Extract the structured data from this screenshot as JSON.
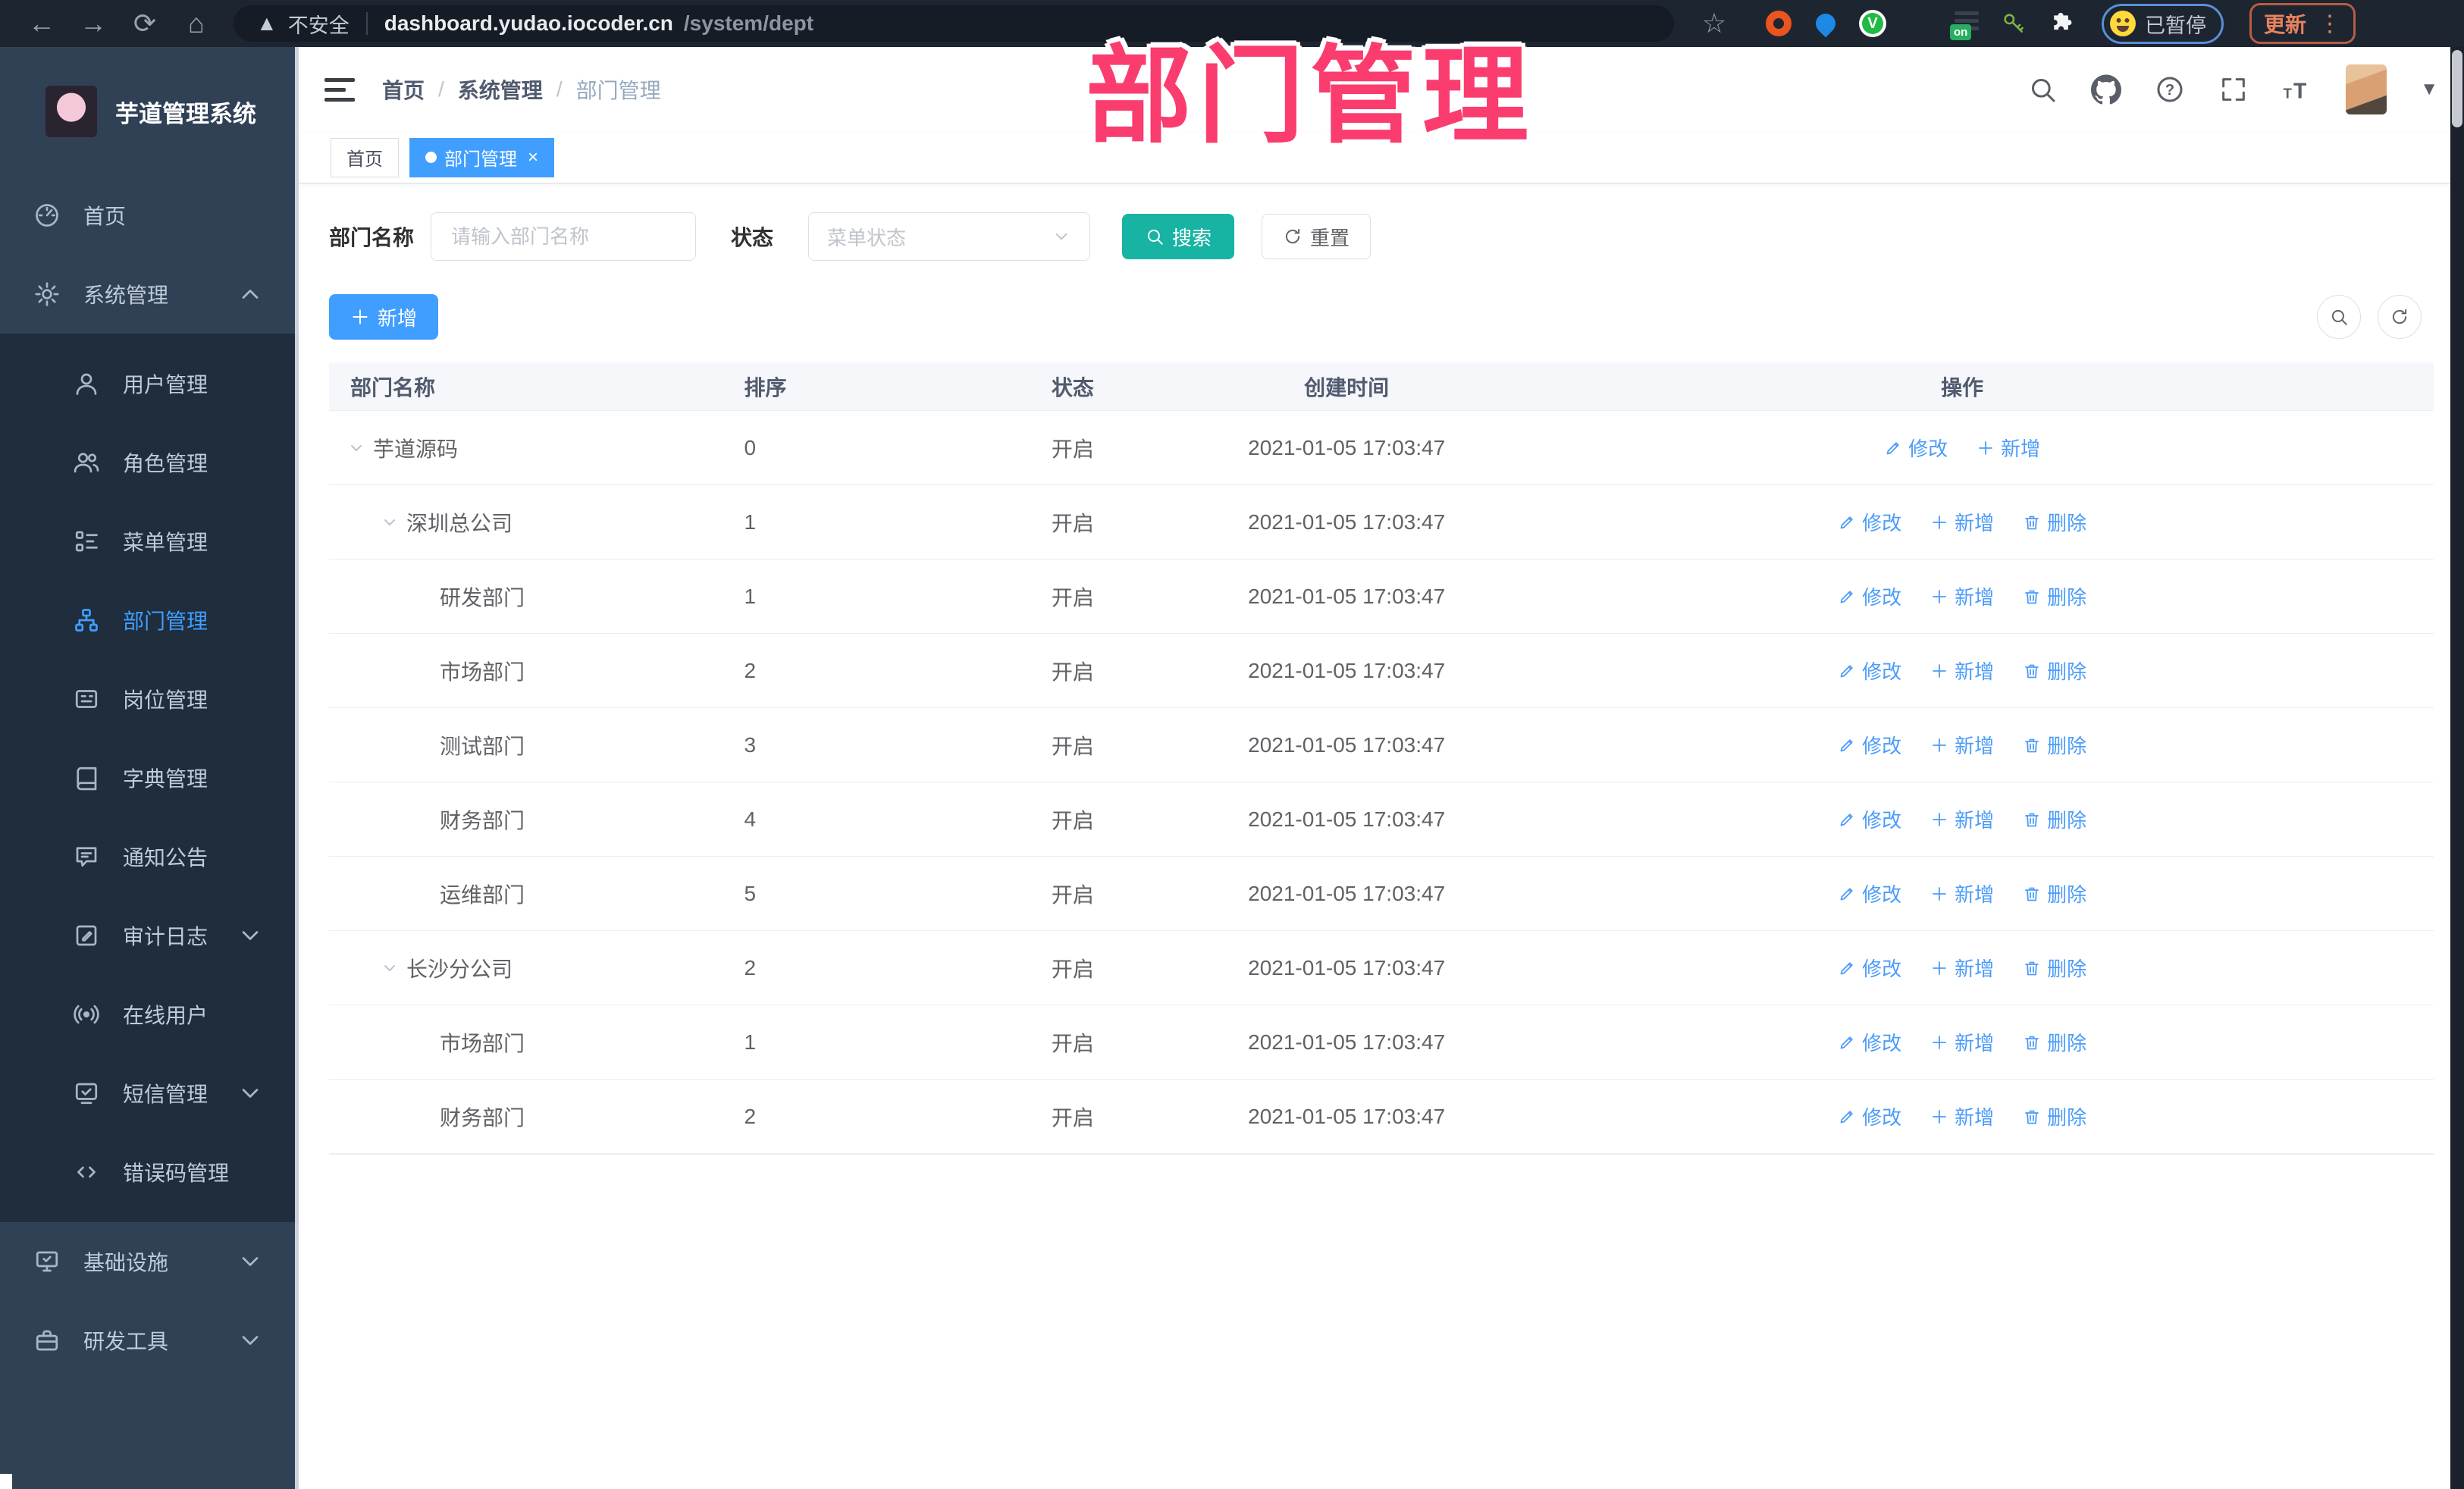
{
  "browser": {
    "security_label": "不安全",
    "url_host": "dashboard.yudao.iocoder.cn",
    "url_path": "/system/dept",
    "paused_label": "已暂停",
    "update_label": "更新"
  },
  "overlay": {
    "title": "部门管理",
    "color": "#fb3c6e"
  },
  "sidebar": {
    "app_title": "芋道管理系统",
    "items": [
      {
        "id": "home",
        "label": "首页",
        "icon": "dashboard-icon",
        "kind": "top"
      },
      {
        "id": "system-management",
        "label": "系统管理",
        "icon": "gear-icon",
        "kind": "top",
        "caret": "up"
      },
      {
        "id": "user-management",
        "label": "用户管理",
        "icon": "user-icon",
        "kind": "sub"
      },
      {
        "id": "role-management",
        "label": "角色管理",
        "icon": "users-icon",
        "kind": "sub"
      },
      {
        "id": "menu-management",
        "label": "菜单管理",
        "icon": "menu-tree-icon",
        "kind": "sub"
      },
      {
        "id": "dept-management",
        "label": "部门管理",
        "icon": "dept-tree-icon",
        "kind": "sub",
        "active": true
      },
      {
        "id": "post-management",
        "label": "岗位管理",
        "icon": "badge-icon",
        "kind": "sub"
      },
      {
        "id": "dict-management",
        "label": "字典管理",
        "icon": "dictionary-icon",
        "kind": "sub"
      },
      {
        "id": "notice-announcement",
        "label": "通知公告",
        "icon": "announcement-icon",
        "kind": "sub"
      },
      {
        "id": "audit-log",
        "label": "审计日志",
        "icon": "audit-log-icon",
        "kind": "sub",
        "caret": "down"
      },
      {
        "id": "online-users",
        "label": "在线用户",
        "icon": "online-users-icon",
        "kind": "sub"
      },
      {
        "id": "sms-management",
        "label": "短信管理",
        "icon": "sms-icon",
        "kind": "sub",
        "caret": "down"
      },
      {
        "id": "error-code-management",
        "label": "错误码管理",
        "icon": "error-code-icon",
        "kind": "sub"
      },
      {
        "id": "infrastructure",
        "label": "基础设施",
        "icon": "infrastructure-icon",
        "kind": "top",
        "caret": "down"
      },
      {
        "id": "dev-tools",
        "label": "研发工具",
        "icon": "devtools-icon",
        "kind": "top",
        "caret": "down"
      }
    ]
  },
  "header": {
    "breadcrumb": [
      "首页",
      "系统管理",
      "部门管理"
    ]
  },
  "tags": [
    {
      "label": "首页",
      "active": false,
      "closable": false
    },
    {
      "label": "部门管理",
      "active": true,
      "closable": true
    }
  ],
  "filter": {
    "name_label": "部门名称",
    "name_placeholder": "请输入部门名称",
    "status_label": "状态",
    "status_placeholder": "菜单状态",
    "search_label": "搜索",
    "reset_label": "重置"
  },
  "toolbar": {
    "add_label": "新增"
  },
  "table": {
    "columns": [
      "部门名称",
      "排序",
      "状态",
      "创建时间",
      "操作"
    ],
    "action_labels": {
      "modify": "修改",
      "add": "新增",
      "delete": "删除"
    },
    "rows": [
      {
        "name": "芋道源码",
        "level": 0,
        "expandable": true,
        "sort": "0",
        "status": "开启",
        "time": "2021-01-05 17:03:47",
        "actions": [
          "modify",
          "add"
        ]
      },
      {
        "name": "深圳总公司",
        "level": 1,
        "expandable": true,
        "sort": "1",
        "status": "开启",
        "time": "2021-01-05 17:03:47",
        "actions": [
          "modify",
          "add",
          "delete"
        ]
      },
      {
        "name": "研发部门",
        "level": 2,
        "expandable": false,
        "sort": "1",
        "status": "开启",
        "time": "2021-01-05 17:03:47",
        "actions": [
          "modify",
          "add",
          "delete"
        ]
      },
      {
        "name": "市场部门",
        "level": 2,
        "expandable": false,
        "sort": "2",
        "status": "开启",
        "time": "2021-01-05 17:03:47",
        "actions": [
          "modify",
          "add",
          "delete"
        ]
      },
      {
        "name": "测试部门",
        "level": 2,
        "expandable": false,
        "sort": "3",
        "status": "开启",
        "time": "2021-01-05 17:03:47",
        "actions": [
          "modify",
          "add",
          "delete"
        ]
      },
      {
        "name": "财务部门",
        "level": 2,
        "expandable": false,
        "sort": "4",
        "status": "开启",
        "time": "2021-01-05 17:03:47",
        "actions": [
          "modify",
          "add",
          "delete"
        ]
      },
      {
        "name": "运维部门",
        "level": 2,
        "expandable": false,
        "sort": "5",
        "status": "开启",
        "time": "2021-01-05 17:03:47",
        "actions": [
          "modify",
          "add",
          "delete"
        ]
      },
      {
        "name": "长沙分公司",
        "level": 1,
        "expandable": true,
        "sort": "2",
        "status": "开启",
        "time": "2021-01-05 17:03:47",
        "actions": [
          "modify",
          "add",
          "delete"
        ]
      },
      {
        "name": "市场部门",
        "level": 2,
        "expandable": false,
        "sort": "1",
        "status": "开启",
        "time": "2021-01-05 17:03:47",
        "actions": [
          "modify",
          "add",
          "delete"
        ]
      },
      {
        "name": "财务部门",
        "level": 2,
        "expandable": false,
        "sort": "2",
        "status": "开启",
        "time": "2021-01-05 17:03:47",
        "actions": [
          "modify",
          "add",
          "delete"
        ]
      }
    ]
  },
  "colors": {
    "primary": "#409eff",
    "search_teal": "#17b3a3",
    "sidebar_bg": "#304156",
    "submenu_bg": "#1f2d3d",
    "annotation_pink": "#fb3c6e"
  }
}
